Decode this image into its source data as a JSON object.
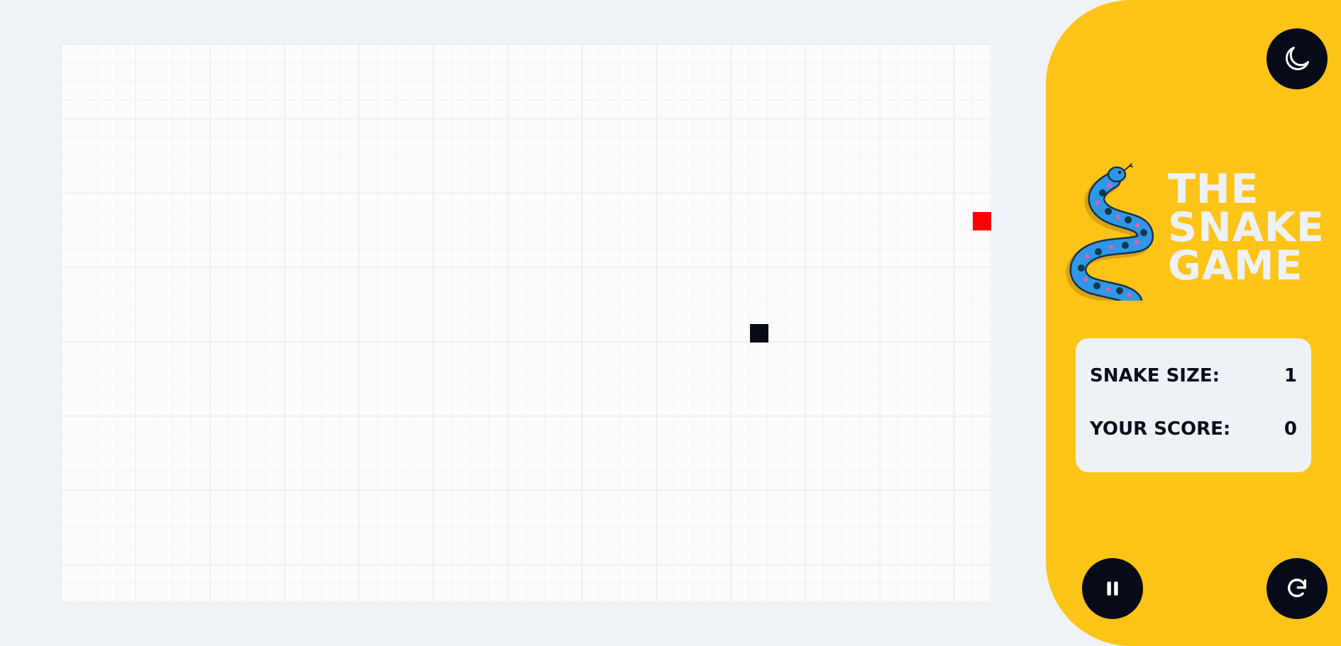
{
  "title": {
    "line1": "THE",
    "line2": "SNAKE",
    "line3": "GAME"
  },
  "stats": {
    "size_label": "SNAKE SIZE:",
    "size_value": "1",
    "score_label": "YOUR SCORE:",
    "score_value": "0"
  },
  "buttons": {
    "theme_icon": "moon-icon",
    "pause_icon": "pause-icon",
    "restart_icon": "restart-icon"
  },
  "colors": {
    "sidebar": "#fdc418",
    "food": "#ff0000",
    "snake": "#070b18",
    "board": "#fbfcfd",
    "button": "#070b18"
  }
}
